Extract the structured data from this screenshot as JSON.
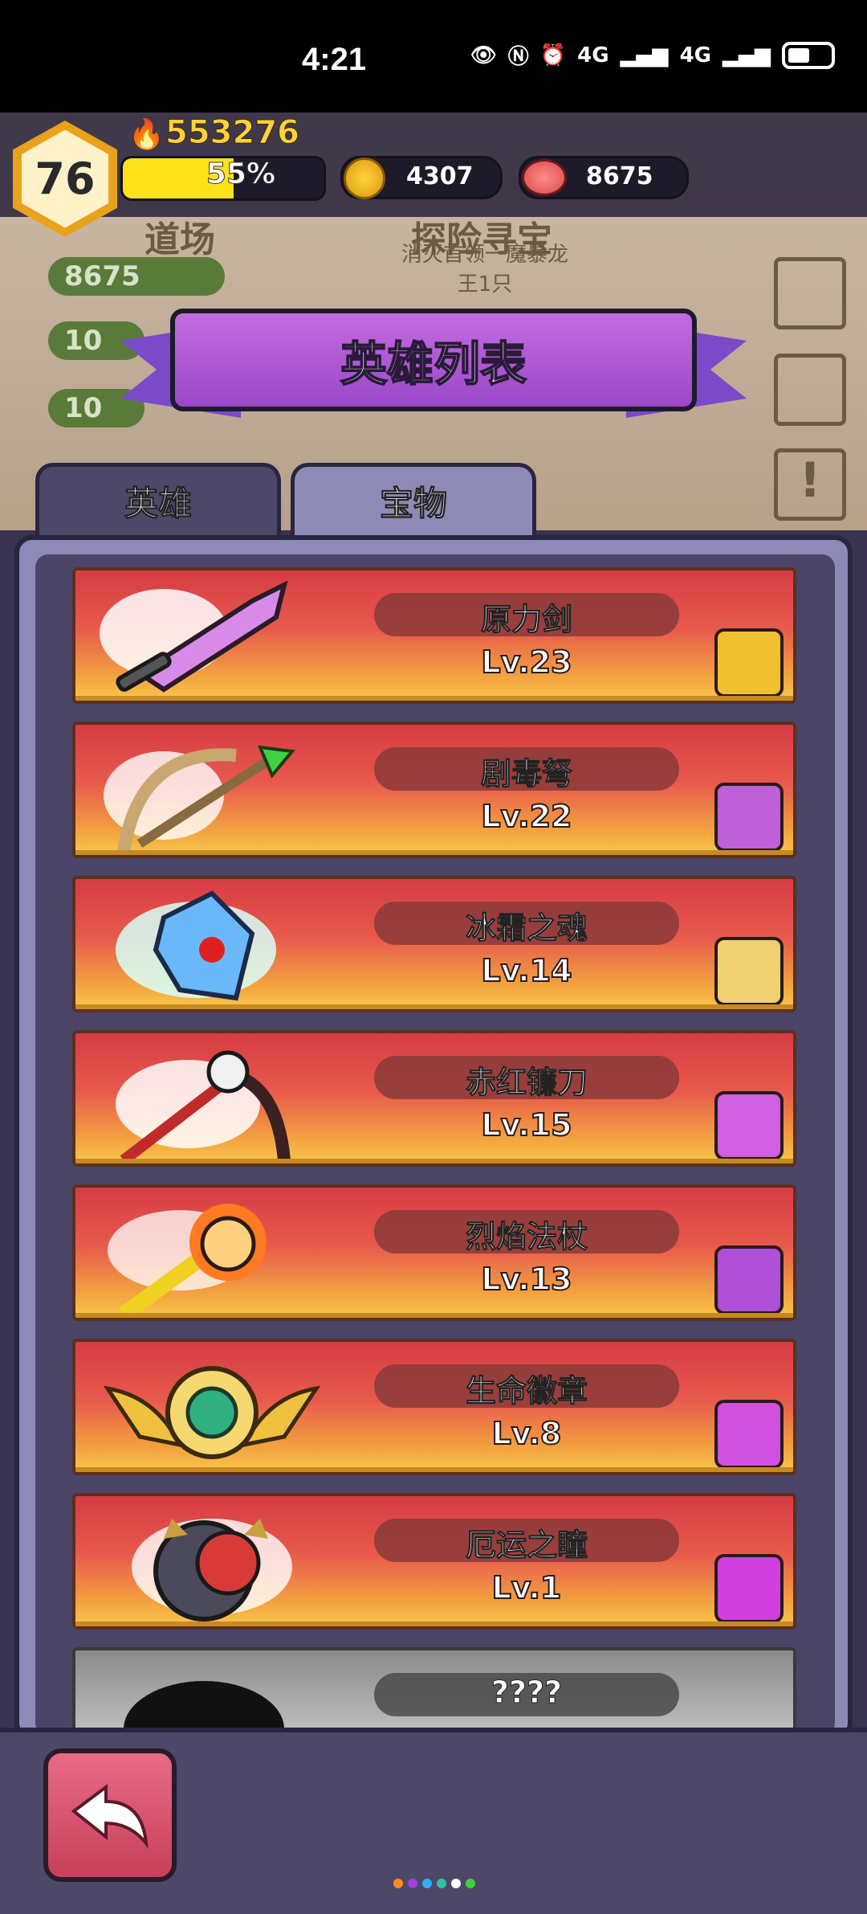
{
  "status_bar": {
    "time": "4:21",
    "network_1": "4G",
    "network_2": "4G"
  },
  "player": {
    "level": "76",
    "power": "553276",
    "xp_percent": "55%",
    "xp_fraction": 0.55,
    "coins": "4307",
    "meat": "8675"
  },
  "background": {
    "dojo_label": "道场",
    "explore_label": "探险寻宝",
    "quest_text": "消灭首领一魔暴龙王1只",
    "meat_amount": "8675",
    "wood_amount": "10",
    "ore_amount": "10"
  },
  "title": "英雄列表",
  "tabs": [
    {
      "label": "英雄",
      "active": false
    },
    {
      "label": "宝物",
      "active": true
    }
  ],
  "treasures": [
    {
      "name": "原力剑",
      "level": "Lv.23",
      "icon": "sword-icon",
      "hero": "knight-hero-avatar"
    },
    {
      "name": "剧毒弩",
      "level": "Lv.22",
      "icon": "crossbow-icon",
      "hero": "armored-hero-avatar"
    },
    {
      "name": "冰霜之魂",
      "level": "Lv.14",
      "icon": "ice-crystal-icon",
      "hero": "gear-mage-avatar"
    },
    {
      "name": "赤红镰刀",
      "level": "Lv.15",
      "icon": "scythe-icon",
      "hero": "bunny-hero-avatar"
    },
    {
      "name": "烈焰法杖",
      "level": "Lv.13",
      "icon": "fire-staff-icon",
      "hero": "skull-wizard-avatar"
    },
    {
      "name": "生命徽章",
      "level": "Lv.8",
      "icon": "life-badge-icon",
      "hero": "slime-hero-avatar"
    },
    {
      "name": "厄运之瞳",
      "level": "Lv.1",
      "icon": "doom-eye-icon",
      "hero": "ninja-hero-avatar"
    },
    {
      "name": "????",
      "level": "",
      "icon": "locked-silhouette-icon",
      "hero": ""
    }
  ],
  "colors": {
    "accent_purple": "#9a48c8",
    "card_red": "#d63c44",
    "card_gold": "#f8c84a",
    "back_button": "#c8405a"
  },
  "page_dots": [
    "#ff8a1a",
    "#a040e0",
    "#30b0ff",
    "#30c0a0",
    "#ffffff",
    "#40d040"
  ]
}
